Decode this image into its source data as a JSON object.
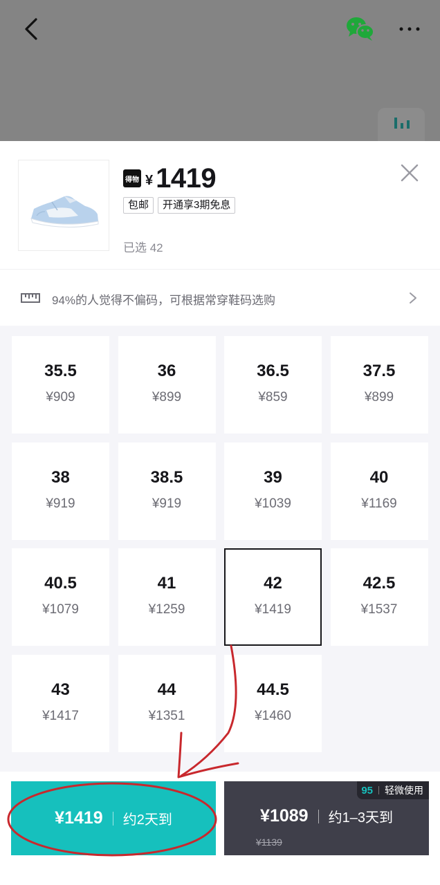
{
  "top_bar": {
    "back_icon": "chevron-left-icon",
    "share_icon": "wechat-icon",
    "more_icon": "more-icon",
    "chart_icon": "bar-chart-icon"
  },
  "product": {
    "brand_badge": "得物",
    "currency": "¥",
    "price": "1419",
    "tags": [
      "包邮",
      "开通享3期免息"
    ],
    "selected_text": "已选 42"
  },
  "fit_tip": {
    "text": "94%的人觉得不偏码，可根据常穿鞋码选购"
  },
  "sizes": [
    {
      "size": "35.5",
      "price": "¥909"
    },
    {
      "size": "36",
      "price": "¥899"
    },
    {
      "size": "36.5",
      "price": "¥859"
    },
    {
      "size": "37.5",
      "price": "¥899"
    },
    {
      "size": "38",
      "price": "¥919"
    },
    {
      "size": "38.5",
      "price": "¥919"
    },
    {
      "size": "39",
      "price": "¥1039"
    },
    {
      "size": "40",
      "price": "¥1169"
    },
    {
      "size": "40.5",
      "price": "¥1079"
    },
    {
      "size": "41",
      "price": "¥1259"
    },
    {
      "size": "42",
      "price": "¥1419"
    },
    {
      "size": "42.5",
      "price": "¥1537"
    },
    {
      "size": "43",
      "price": "¥1417"
    },
    {
      "size": "44",
      "price": "¥1351"
    },
    {
      "size": "44.5",
      "price": "¥1460"
    }
  ],
  "selected_size_index": 10,
  "buy_options": {
    "fast": {
      "price": "¥1419",
      "delivery": "约2天到"
    },
    "used": {
      "price": "¥1089",
      "delivery": "约1–3天到",
      "original_price": "¥1139",
      "badge_number": "95",
      "badge_text": "轻微使用"
    }
  },
  "colors": {
    "accent": "#16c0bd",
    "dark_button": "#3f3f4a",
    "annotation": "#c8282d"
  }
}
